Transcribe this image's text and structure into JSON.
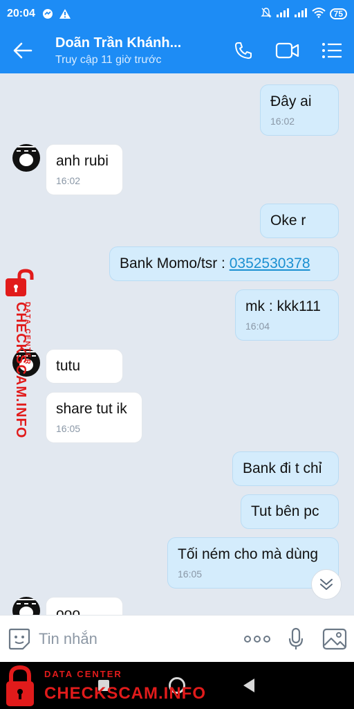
{
  "status_bar": {
    "time": "20:04",
    "battery": "75"
  },
  "header": {
    "contact_name": "Doãn Trần Khánh...",
    "last_seen": "Truy cập 11 giờ trước"
  },
  "messages": [
    {
      "dir": "out",
      "text": "Đây ai",
      "time": "16:02"
    },
    {
      "dir": "in",
      "text": "anh rubi",
      "time": "16:02"
    },
    {
      "dir": "out",
      "text": "Oke r"
    },
    {
      "dir": "out",
      "text_prefix": "Bank Momo/tsr : ",
      "link": "0352530378"
    },
    {
      "dir": "out",
      "text": "mk : kkk111",
      "time": "16:04"
    },
    {
      "dir": "in",
      "text": "tutu"
    },
    {
      "dir": "in",
      "text": "share tut ik",
      "time": "16:05"
    },
    {
      "dir": "out",
      "text": "Bank đi t chỉ"
    },
    {
      "dir": "out",
      "text": "Tut bên pc"
    },
    {
      "dir": "out",
      "text": "Tối ném cho mà dùng",
      "time": "16:05"
    },
    {
      "dir": "in",
      "text": "ooo"
    }
  ],
  "input": {
    "placeholder": "Tin nhắn"
  },
  "watermark": {
    "small": "DATA CENTER",
    "big": "CHECKSCAM.INFO"
  },
  "colors": {
    "header_bg": "#1d8cf5",
    "bubble_out": "#d4ecfc",
    "bubble_in": "#ffffff",
    "chat_bg": "#e2e8f0",
    "link": "#1a8fd1",
    "watermark": "#e11b1b"
  }
}
